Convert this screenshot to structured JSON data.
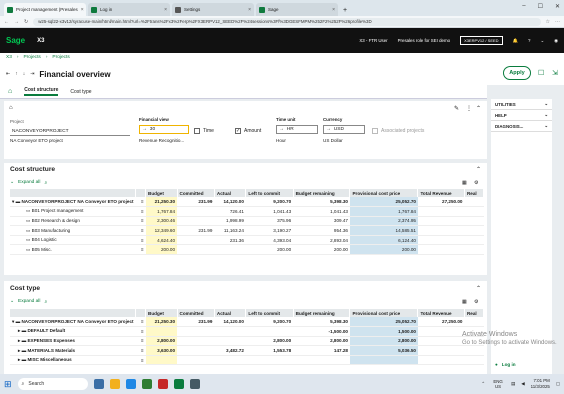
{
  "browser": {
    "tabs": [
      {
        "label": "Project management (Presales"
      },
      {
        "label": "Log in"
      },
      {
        "label": "Settings"
      },
      {
        "label": "Sage"
      }
    ],
    "url": "w25-sql22-x3v12/syracuse-main/html/main.html?url=%2Ftrans%2Fx3%2Ferp%2FX3ERPV12_SEED%2F%24sessions%3Ff%3DGESFMPM%252F2%252F%26profile%3D"
  },
  "app": {
    "logo": "Sage",
    "product": "X3",
    "user": "X3 - FTR User",
    "role": "Presales role for SEI demo",
    "folder": "X3ERPV12 / SEED",
    "breadcrumb": [
      "X3",
      "Projects",
      "Projects"
    ],
    "title": "Financial overview",
    "apply_label": "Apply"
  },
  "tabs": [
    "Cost structure",
    "Cost type"
  ],
  "criteria": {
    "project_label": "Project",
    "project_value": "NACONVEYORPROJECT",
    "project_desc": "NA Conveyor ETO project",
    "fin_view_label": "Financial view",
    "fin_view_value": "30",
    "fin_view_desc": "Revenue Recognitio...",
    "time_label": "Time",
    "amount_label": "Amount",
    "time_unit_label": "Time unit",
    "time_unit_value": "HR",
    "time_unit_desc": "Hour",
    "currency_label": "Currency",
    "currency_value": "USD",
    "currency_desc": "US Dollar",
    "assoc_label": "Associated projects"
  },
  "sidebar": [
    "UTILITIES",
    "HELP",
    "DIAGNOSIS..."
  ],
  "cost_structure": {
    "title": "Cost structure",
    "expand": "Expand all",
    "columns": [
      "Budget",
      "Committed",
      "Actual",
      "Left to commit",
      "Budget remaining",
      "Provisional cost price",
      "Total Revenue",
      "Real"
    ],
    "rows": [
      {
        "name": "NACONVEYORPROJECT NA Conveyor ETO project",
        "v": [
          "21,250.30",
          "231.99",
          "14,120.00",
          "9,200.70",
          "5,398.30",
          "25,052.70",
          "27,250.00",
          ""
        ]
      },
      {
        "name": "B01 Project management",
        "v": [
          "1,767.84",
          "",
          "726.41",
          "1,041.43",
          "1,041.43",
          "1,767.84",
          "",
          ""
        ]
      },
      {
        "name": "B02 Research & design",
        "v": [
          "2,300.46",
          "",
          "1,998.99",
          "375.96",
          "309.47",
          "2,374.95",
          "",
          ""
        ]
      },
      {
        "name": "B03 Manufacturing",
        "v": [
          "12,349.60",
          "231.99",
          "11,163.24",
          "3,190.27",
          "954.36",
          "14,585.51",
          "",
          ""
        ]
      },
      {
        "name": "B04 Logistic",
        "v": [
          "4,624.40",
          "",
          "231.36",
          "4,393.04",
          "2,893.04",
          "6,124.40",
          "",
          ""
        ]
      },
      {
        "name": "B05 Misc.",
        "v": [
          "200.00",
          "",
          "",
          "200.00",
          "200.00",
          "200.00",
          "",
          ""
        ]
      }
    ]
  },
  "cost_type": {
    "title": "Cost type",
    "expand": "Expand all",
    "columns": [
      "Budget",
      "Committed",
      "Actual",
      "Left to commit",
      "Budget remaining",
      "Provisional cost price",
      "Total Revenue",
      "Real"
    ],
    "rows": [
      {
        "name": "NACONVEYORPROJECT NA Conveyor ETO project",
        "v": [
          "21,250.30",
          "231.99",
          "14,120.00",
          "9,200.70",
          "5,398.30",
          "25,052.70",
          "27,250.00",
          ""
        ]
      },
      {
        "name": "DEFAULT Default",
        "v": [
          "",
          "",
          "",
          "",
          "-1,500.00",
          "1,500.00",
          "",
          ""
        ]
      },
      {
        "name": "EXPENSES Expenses",
        "v": [
          "2,800.00",
          "",
          "",
          "2,800.00",
          "2,800.00",
          "2,800.00",
          "",
          ""
        ]
      },
      {
        "name": "MATERIALS Materials",
        "v": [
          "3,630.00",
          "",
          "3,482.72",
          "1,553.78",
          "147.28",
          "5,036.50",
          "",
          ""
        ]
      },
      {
        "name": "MISC Miscellaneous",
        "v": [
          "",
          "",
          "",
          "",
          "",
          "",
          "",
          ""
        ]
      }
    ]
  },
  "windows": {
    "line1": "Activate Windows",
    "line2": "Go to Settings to activate Windows.",
    "search": "Search",
    "lang": "ENG US",
    "time": "7:01 PM",
    "date": "11/3/2025",
    "login": "Log in"
  },
  "colors": {
    "accent": "#0a7c3e",
    "yellow": "#fff9c8",
    "blue": "#cfe3ef"
  }
}
